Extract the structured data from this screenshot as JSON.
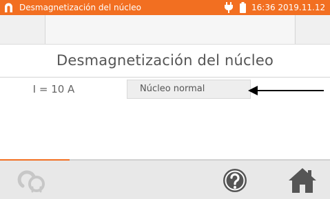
{
  "status_bar": {
    "app_title": "Desmagnetización del núcleo",
    "clock": "16:36 2019.11.12",
    "logo_icon": "horseshoe-magnet-icon",
    "power_icon": "plug-icon",
    "battery_icon": "battery-icon"
  },
  "screen": {
    "title": "Desmagnetización del núcleo",
    "current_label": "I = 10 A",
    "mode_value": "Núcleo normal",
    "pointer_icon": "arrow-left-icon"
  },
  "progress": {
    "fraction": 0.21
  },
  "footer": {
    "coil_icon": "coil-icon",
    "help_icon": "help-icon",
    "home_icon": "home-icon"
  },
  "colors": {
    "accent": "#f26f21",
    "icon_gray": "#555555",
    "disabled_gray": "#c7c7c7"
  }
}
